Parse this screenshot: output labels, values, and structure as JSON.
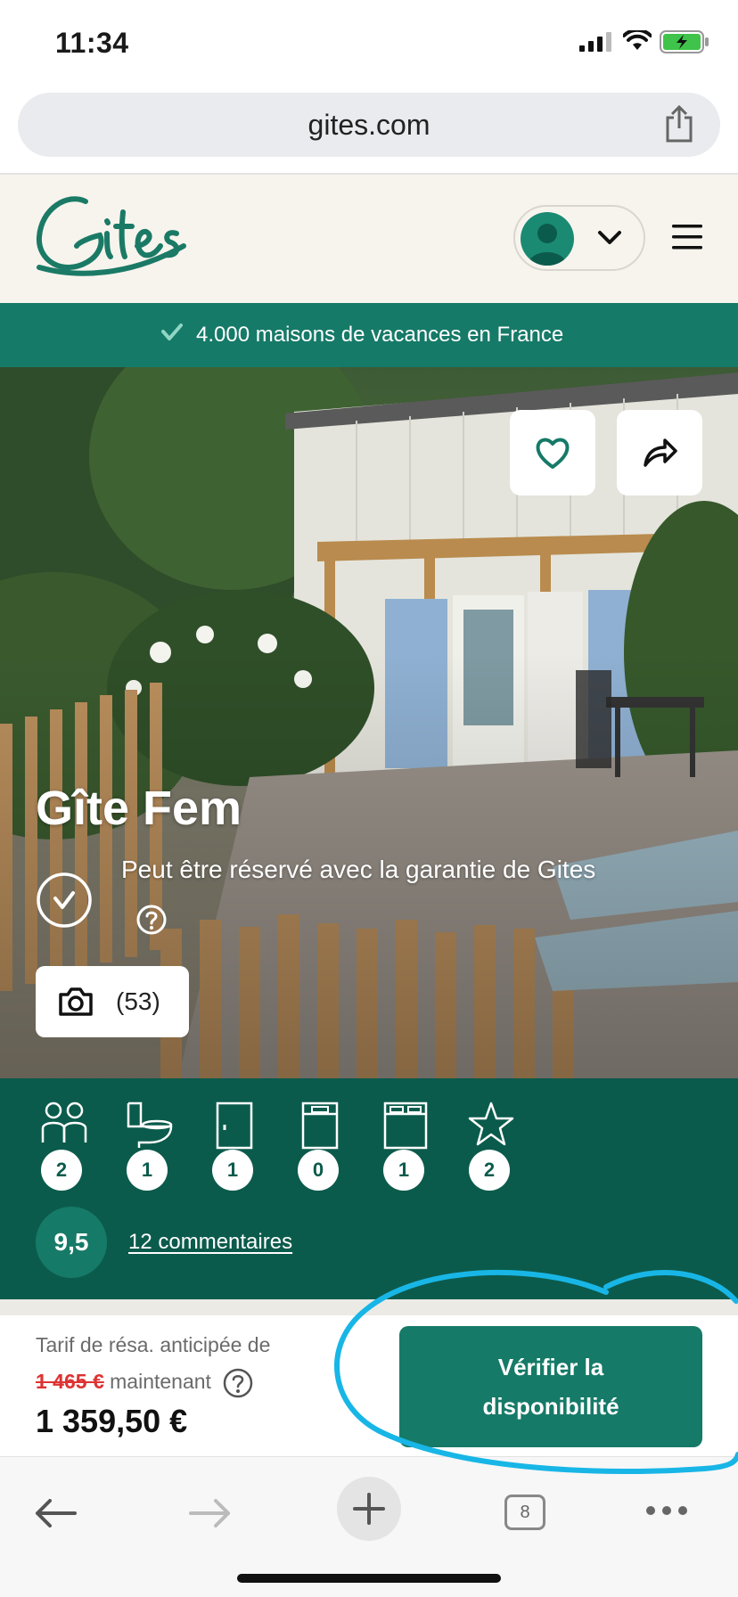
{
  "status": {
    "time": "11:34"
  },
  "browser": {
    "url": "gites.com",
    "tab_count": "8"
  },
  "header": {
    "logo_text": "Gites"
  },
  "banner": {
    "text": "4.000 maisons de vacances en France"
  },
  "listing": {
    "title": "Gîte Fem",
    "guarantee": "Peut être réservé avec la garantie de Gites",
    "photo_count": "(53)"
  },
  "features": [
    {
      "icon": "guests-icon",
      "value": "2"
    },
    {
      "icon": "toilet-icon",
      "value": "1"
    },
    {
      "icon": "door-icon",
      "value": "1"
    },
    {
      "icon": "single-bed-icon",
      "value": "0"
    },
    {
      "icon": "double-bed-icon",
      "value": "1"
    },
    {
      "icon": "star-icon",
      "value": "2"
    }
  ],
  "rating": {
    "score": "9,5",
    "comments": "12 commentaires"
  },
  "price": {
    "label": "Tarif de résa. anticipée de",
    "old_price": "1 465 €",
    "now_label": "maintenant",
    "current_price": "1 359,50 €"
  },
  "cta": {
    "line1": "Vérifier la",
    "line2": "disponibilité"
  },
  "colors": {
    "brand": "#167a68",
    "brand_dark": "#0b5b4c",
    "annotation": "#18b6e6"
  }
}
